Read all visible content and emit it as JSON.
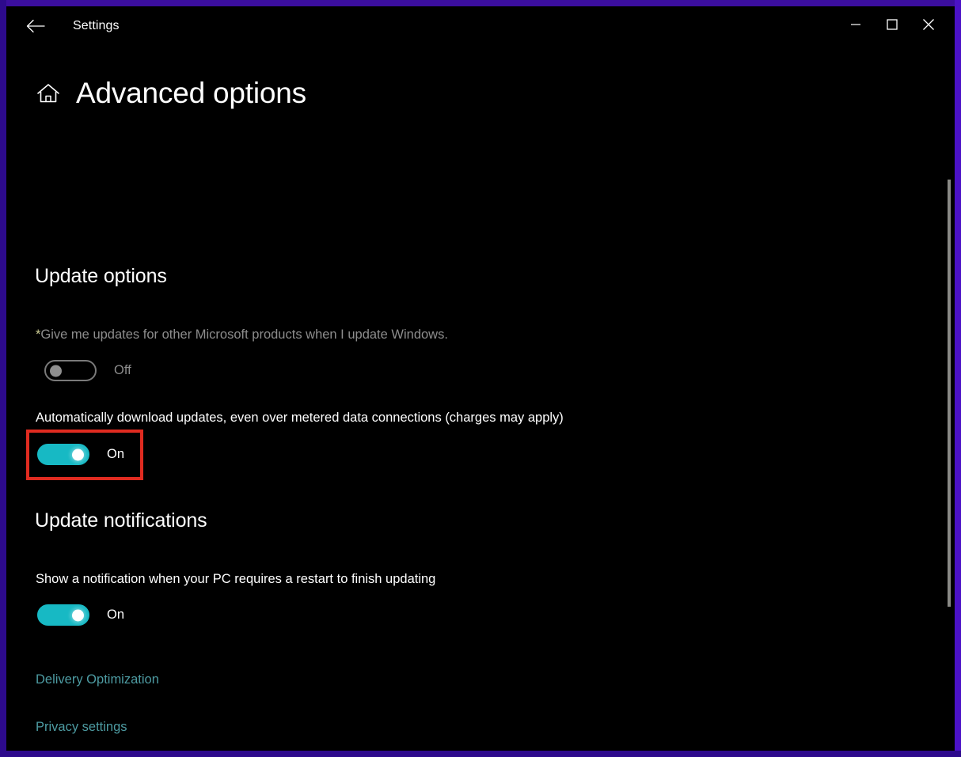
{
  "window": {
    "titlebar": {
      "back_label": "Back",
      "title": "Settings",
      "back_icon": "arrow-left-icon",
      "minimize_icon": "minimize-icon",
      "maximize_icon": "maximize-icon",
      "close_icon": "close-icon"
    },
    "accent_color": "#17b9c4",
    "link_color": "#4d9ba2",
    "background_color": "#000000",
    "frame_color": "#2d0a8c",
    "highlight_color": "#e02b20"
  },
  "page": {
    "home_icon": "home-icon",
    "title": "Advanced options"
  },
  "sections": [
    {
      "heading": "Update options",
      "settings": [
        {
          "asterisk": "*",
          "label": "Give me updates for other Microsoft products when I update Windows.",
          "state": "Off",
          "enabled": false,
          "highlighted": false
        },
        {
          "asterisk": "",
          "label": "Automatically download updates, even over metered data connections (charges may apply)",
          "state": "On",
          "enabled": true,
          "highlighted": true
        }
      ]
    },
    {
      "heading": "Update notifications",
      "settings": [
        {
          "asterisk": "",
          "label": "Show a notification when your PC requires a restart to finish updating",
          "state": "On",
          "enabled": true,
          "highlighted": false
        }
      ]
    }
  ],
  "links": [
    {
      "label": "Delivery Optimization"
    },
    {
      "label": "Privacy settings"
    }
  ],
  "scrollbar": {
    "name": "vertical-scrollbar"
  }
}
